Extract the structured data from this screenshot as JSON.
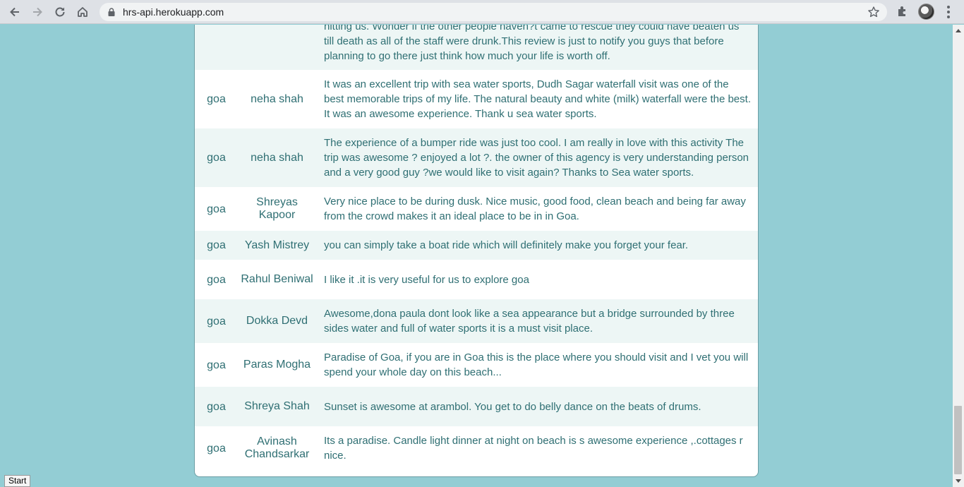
{
  "browser": {
    "url": "hrs-api.herokuapp.com"
  },
  "reviews": [
    {
      "city": "",
      "name": "",
      "review": "hitting us. Wonder if the other people haven?t came to rescue they could have beaten us till death as all of the staff were drunk.This review is just to notify you guys that before planning to go there just think how much your life is worth off."
    },
    {
      "city": "goa",
      "name": "neha shah",
      "review": "It was an excellent trip with sea water sports, Dudh Sagar waterfall visit was one of the best memorable trips of my life. The natural beauty and white (milk) waterfall were the best. It was an awesome experience. Thank u sea water sports."
    },
    {
      "city": "goa",
      "name": "neha shah",
      "review": "The experience of a bumper ride was just too cool. I am really in love with this activity The trip was awesome ? enjoyed a lot ?. the owner of this agency is very understanding person and a very good guy ?we would like to visit again? Thanks to Sea water sports."
    },
    {
      "city": "goa",
      "name": "Shreyas Kapoor",
      "review": "Very nice place to be during dusk. Nice music, good food, clean beach and being far away from the crowd makes it an ideal place to be in in Goa."
    },
    {
      "city": "goa",
      "name": "Yash Mistrey",
      "review": "you can simply take a boat ride which will definitely make you forget your fear."
    },
    {
      "city": "goa",
      "name": "Rahul Beniwal",
      "review": "I like it .it is very useful for us to explore goa"
    },
    {
      "city": "goa",
      "name": "Dokka Devd",
      "review": "Awesome,dona paula dont look like a sea appearance but a bridge surrounded by three sides water and full of water sports it is a must visit place."
    },
    {
      "city": "goa",
      "name": "Paras Mogha",
      "review": "Paradise of Goa, if you are in Goa this is the place where you should visit and I vet you will spend your whole day on this beach..."
    },
    {
      "city": "goa",
      "name": "Shreya Shah",
      "review": "Sunset is awesome at arambol. You get to do belly dance on the beats of drums."
    },
    {
      "city": "goa",
      "name": "Avinash Chandsarkar",
      "review": "Its a paradise. Candle light dinner at night on beach is s awesome experience ,.cottages r nice."
    }
  ],
  "start_button": "Start"
}
